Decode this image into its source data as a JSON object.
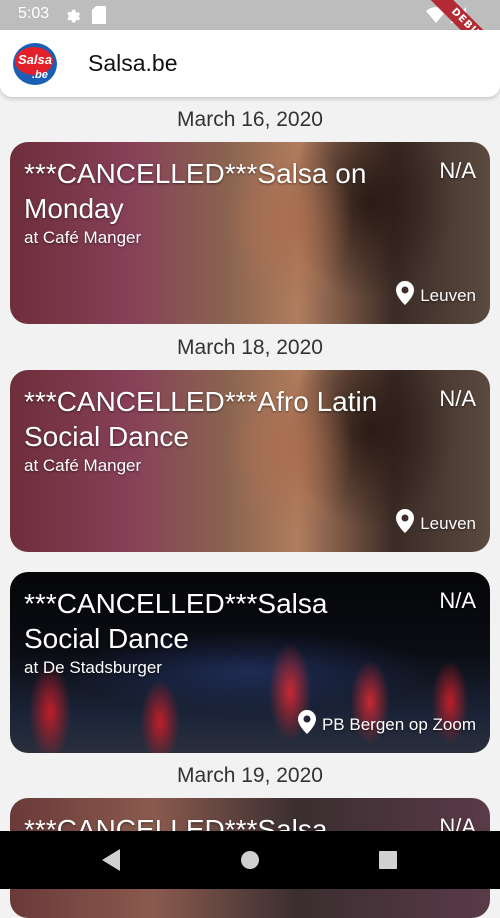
{
  "status_bar": {
    "time": "5:03",
    "icons": [
      "gear-icon",
      "sd-card-icon",
      "wifi-icon",
      "signal-icon",
      "battery-icon"
    ],
    "debug_banner": "DEBUG"
  },
  "app_bar": {
    "logo_text_top": "Salsa",
    "logo_text_bottom": ".be",
    "title": "Salsa.be"
  },
  "events": [
    {
      "date": "March 16, 2020",
      "title": "***CANCELLED***Salsa on Monday",
      "venue": "at Café Manger",
      "price": "N/A",
      "location": "Leuven"
    },
    {
      "date": "March 18, 2020",
      "title": "***CANCELLED***Afro Latin Social Dance",
      "venue": "at Café Manger",
      "price": "N/A",
      "location": "Leuven"
    },
    {
      "date": "",
      "title": "***CANCELLED***Salsa Social Dance",
      "venue": "at De Stadsburger",
      "price": "N/A",
      "location": "PB Bergen op Zoom"
    },
    {
      "date": "March 19, 2020",
      "title": "***CANCELLED***Salsa",
      "venue": "",
      "price": "N/A",
      "location": ""
    }
  ],
  "nav_bar": {
    "icons": [
      "back-icon",
      "home-icon",
      "recents-icon"
    ]
  },
  "colors": {
    "status_bar": "#bdbdbd",
    "background": "#f2f2f2",
    "debug_ribbon": "#b22a33",
    "logo_red": "#e3202a",
    "logo_blue": "#1a5fb4"
  }
}
